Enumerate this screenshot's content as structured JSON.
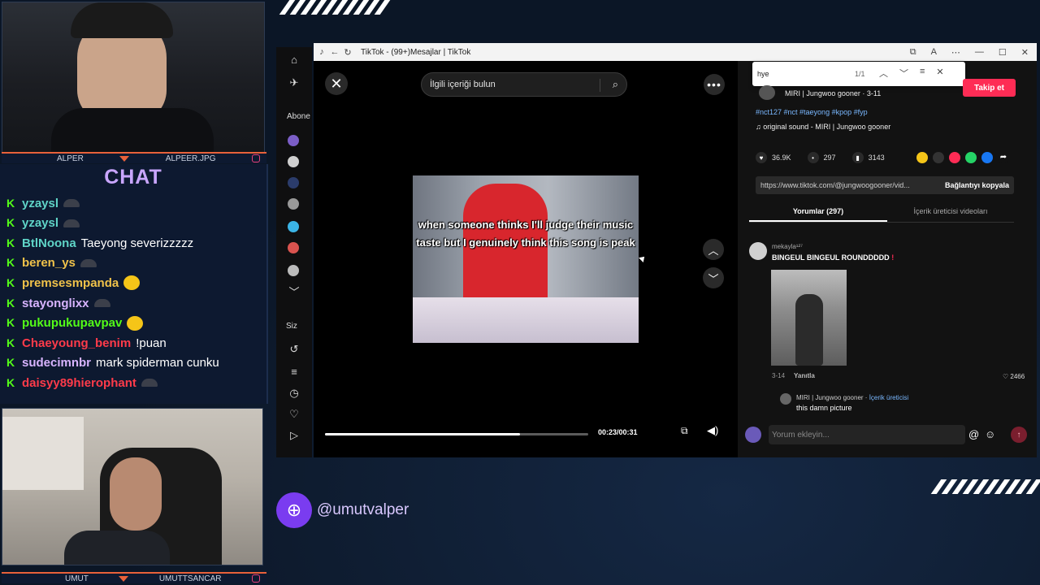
{
  "stream": {
    "cam_top_name_left": "ALPER",
    "cam_top_name_right": "ALPEER.JPG",
    "cam_bottom_name_left": "UMUT",
    "cam_bottom_name_right": "UMUTTSANCAR",
    "social_handle": "@umutvalper",
    "chat_title": "CHAT",
    "chat": [
      {
        "user": "yzaysl",
        "msg": "",
        "color": "#5fd4c7",
        "emote": "dark"
      },
      {
        "user": "yzaysl",
        "msg": "",
        "color": "#5fd4c7",
        "emote": "dark"
      },
      {
        "user": "BtlNoona",
        "msg": "Taeyong severizzzzz",
        "color": "#5fd4c7",
        "emote": ""
      },
      {
        "user": "beren_ys",
        "msg": "",
        "color": "#f0c24a",
        "emote": "dark"
      },
      {
        "user": "premsesmpanda",
        "msg": "",
        "color": "#f0c24a",
        "emote": "yellow"
      },
      {
        "user": "stayonglixx",
        "msg": "",
        "color": "#d8b4ff",
        "emote": "dark"
      },
      {
        "user": "pukupukupavpav",
        "msg": "",
        "color": "#53fc18",
        "emote": "yellow"
      },
      {
        "user": "Chaeyoung_benim",
        "msg": "!puan",
        "color": "#ff3b4a",
        "emote": ""
      },
      {
        "user": "sudecimnbr",
        "msg": "mark spiderman cunku",
        "color": "#d8b4ff",
        "emote": ""
      },
      {
        "user": "daisyy89hierophant",
        "msg": "",
        "color": "#ff3b4a",
        "emote": "dark"
      }
    ]
  },
  "browser": {
    "title": "TikTok - (99+)Mesajlar | TikTok"
  },
  "rail": {
    "following_label": "Abone",
    "you_label": "Siz"
  },
  "video": {
    "search_placeholder": "İlgili içeriği bulun",
    "caption": "when someone thinks I'll judge their music taste but I genuinely think this song is peak",
    "time": "00:23/00:31",
    "progress": 0.74
  },
  "find": {
    "query": "hye",
    "count": "1/1"
  },
  "post": {
    "author": "MIRI | Jungwoo gooner · 3-11",
    "follow_label": "Takip et",
    "hashtags": "#nct127 #nct #taeyong #kpop #fyp",
    "sound": "original sound - MIRI | Jungwoo gooner",
    "likes": "36.9K",
    "comments": "297",
    "saves": "3143",
    "link": "https://www.tiktok.com/@jungwoogooner/vid...",
    "copy_link_label": "Bağlantıyı kopyala",
    "tab_comments": "Yorumlar (297)",
    "tab_creator": "İçerik üreticisi videoları"
  },
  "comment": {
    "user": "mekayla¹²⁷",
    "text": "BINGEUL BINGEUL ROUNDDDDD",
    "date": "3-14",
    "reply_label": "Yanıtla",
    "likes": "2466",
    "reply_author": "MIRI | Jungwoo gooner",
    "reply_tag": "İçerik üreticisi",
    "reply_text": "this damn picture"
  },
  "input": {
    "placeholder": "Yorum ekleyin..."
  },
  "icons": {
    "home": "⌂",
    "explore": "✈",
    "close": "✕",
    "search": "⌕",
    "more": "•••",
    "up": "︿",
    "down": "﹀",
    "volume": "🔊",
    "heart": "♥",
    "comment": "💬",
    "bookmark": "🔖"
  },
  "colors": {
    "follow": "#fe2c55",
    "kick_green": "#53fc18",
    "accent_orange": "#e8613a"
  }
}
